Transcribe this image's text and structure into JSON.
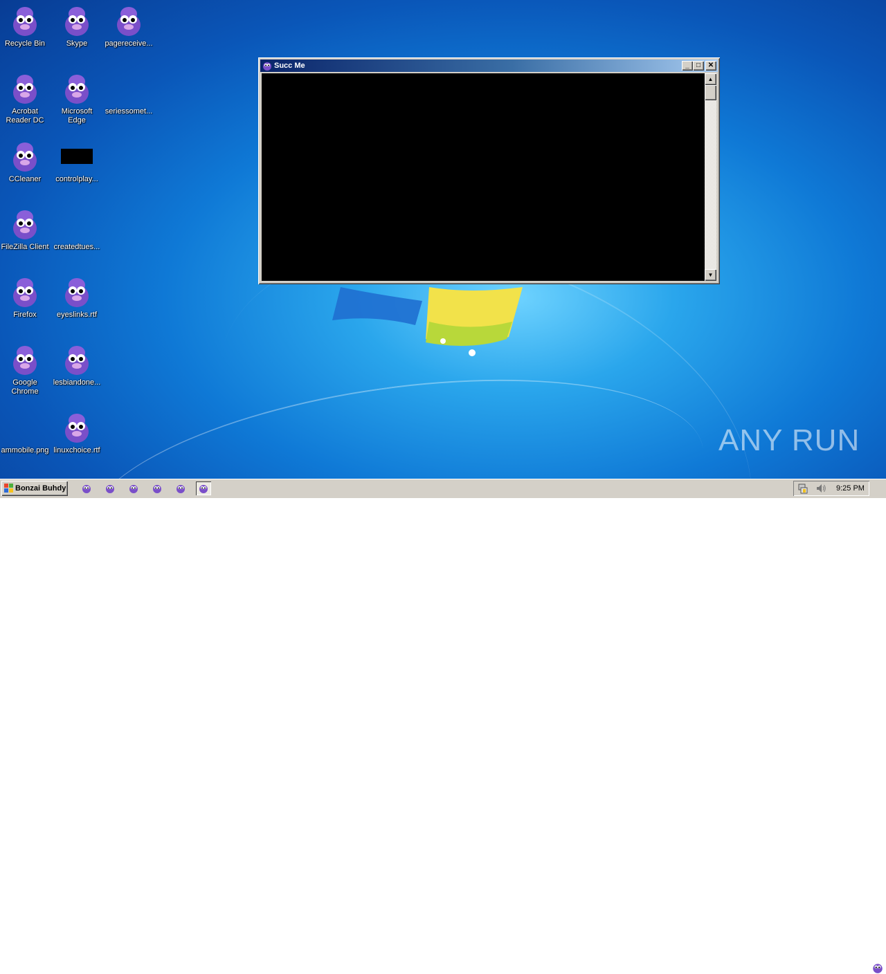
{
  "desktop_icons": [
    {
      "label": "Recycle Bin",
      "kind": "bonzi"
    },
    {
      "label": "Skype",
      "kind": "bonzi"
    },
    {
      "label": "pagereceive...",
      "kind": "bonzi"
    },
    {
      "label": "Acrobat Reader DC",
      "kind": "bonzi"
    },
    {
      "label": "Microsoft Edge",
      "kind": "bonzi"
    },
    {
      "label": "seriessomet...",
      "kind": "blank"
    },
    {
      "label": "CCleaner",
      "kind": "bonzi"
    },
    {
      "label": "controlplay...",
      "kind": "black"
    },
    {
      "label": "FileZilla Client",
      "kind": "bonzi"
    },
    {
      "label": "createdtues...",
      "kind": "blank"
    },
    {
      "label": "Firefox",
      "kind": "bonzi"
    },
    {
      "label": "eyeslinks.rtf",
      "kind": "bonzi"
    },
    {
      "label": "Google Chrome",
      "kind": "bonzi"
    },
    {
      "label": "lesbiandone...",
      "kind": "bonzi"
    },
    {
      "label": "ammobile.png",
      "kind": "blank"
    },
    {
      "label": "linuxchoice.rtf",
      "kind": "bonzi"
    }
  ],
  "window": {
    "title": "Succ Me",
    "minimize_glyph": "_",
    "maximize_glyph": "□",
    "close_glyph": "✕",
    "scroll_up_glyph": "▲",
    "scroll_down_glyph": "▼"
  },
  "taskbar": {
    "start_label": "Bonzai Buhdy",
    "quick_launch_icons": [
      "bonzi-icon",
      "bonzi-icon",
      "bonzi-icon",
      "bonzi-icon",
      "bonzi-icon",
      "bonzi-icon"
    ],
    "clock": "9:25 PM"
  },
  "watermark": "ANY RUN",
  "colors": {
    "title_start": "#0a246a",
    "title_end": "#a6caf0",
    "bonzi_purple": "#7a4fc9"
  }
}
